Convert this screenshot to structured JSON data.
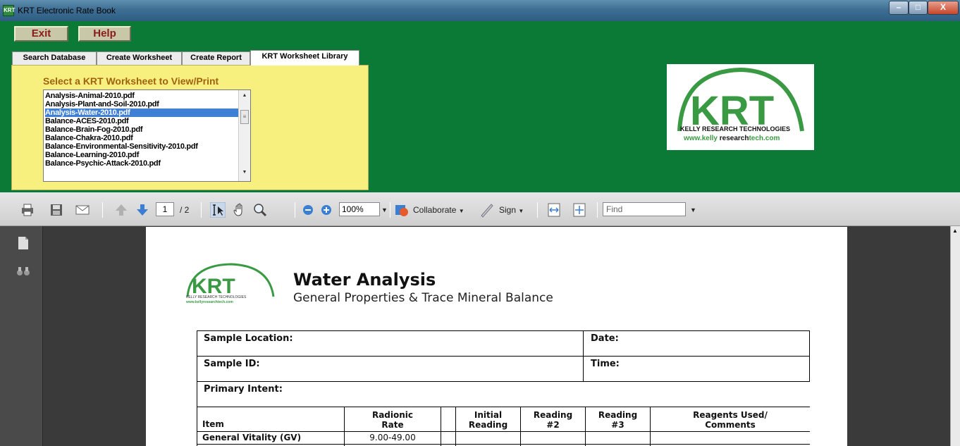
{
  "window": {
    "title": "KRT Electronic Rate Book",
    "app_icon_text": "KRT"
  },
  "menu": {
    "exit_label": "Exit",
    "help_label": "Help"
  },
  "tabs": [
    {
      "label": "Search Database"
    },
    {
      "label": "Create Worksheet"
    },
    {
      "label": "Create Report"
    },
    {
      "label": "KRT Worksheet Library"
    }
  ],
  "library": {
    "prompt": "Select a KRT Worksheet to View/Print",
    "items": [
      "Analysis-Animal-2010.pdf",
      "Analysis-Plant-and-Soil-2010.pdf",
      "Analysis-Water-2010.pdf",
      "Balance-ACES-2010.pdf",
      "Balance-Brain-Fog-2010.pdf",
      "Balance-Chakra-2010.pdf",
      "Balance-Environmental-Sensitivity-2010.pdf",
      "Balance-Learning-2010.pdf",
      "Balance-Psychic-Attack-2010.pdf"
    ],
    "selected_index": 2
  },
  "logo": {
    "letters": "KRT",
    "company": "KELLY RESEARCH TECHNOLOGIES",
    "url_prefix": "www.kelly ",
    "url_bold": "research",
    "url_suffix": "tech.com",
    "brand_green": "#3a9a43"
  },
  "pdf_toolbar": {
    "page_current": "1",
    "page_total": "/ 2",
    "zoom": "100%",
    "collaborate_label": "Collaborate",
    "sign_label": "Sign",
    "find_placeholder": "Find"
  },
  "document": {
    "logo_letters": "KRT",
    "logo_company": "KELLY RESEARCH TECHNOLOGIES",
    "logo_url": "www.kellyresearchtech.com",
    "title": "Water Analysis",
    "subtitle": "General Properties & Trace Mineral Balance",
    "fields": {
      "sample_location": "Sample Location:",
      "date": "Date:",
      "sample_id": "Sample ID:",
      "time": "Time:",
      "primary_intent": "Primary Intent:"
    },
    "columns": {
      "item": "Item",
      "radionic_1": "Radionic",
      "radionic_2": "Rate",
      "initial_1": "Initial",
      "initial_2": "Reading",
      "reading2_1": "Reading",
      "reading2_2": "#2",
      "reading3_1": "Reading",
      "reading3_2": "#3",
      "reagents_1": "Reagents Used/",
      "reagents_2": "Comments"
    },
    "rows": [
      {
        "item": "General Vitality (GV)",
        "rate": "9.00-49.00"
      }
    ]
  }
}
